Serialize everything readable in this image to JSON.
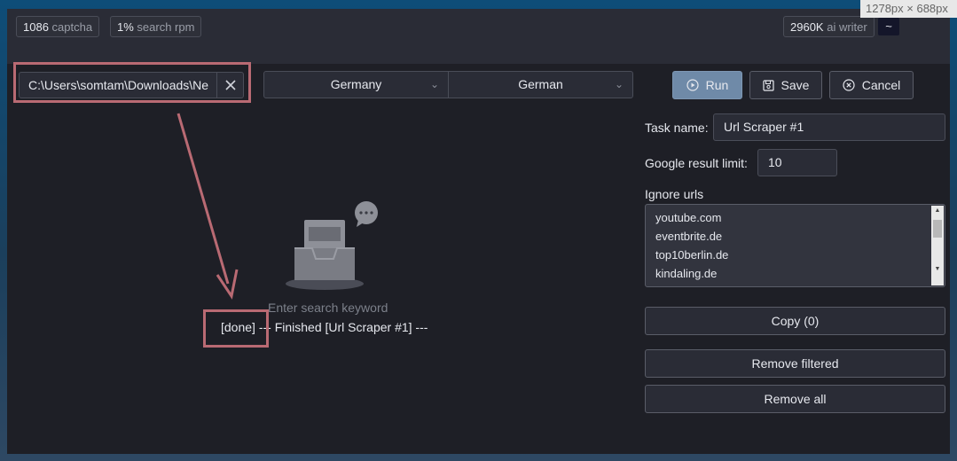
{
  "stats": {
    "captcha": {
      "value": "1086",
      "unit": "captcha"
    },
    "search_rpm": {
      "value": "1%",
      "unit": "search rpm"
    },
    "ai_writer": {
      "value": "2960K",
      "unit": "ai writer"
    },
    "tilde": "~"
  },
  "size_tooltip": "1278px × 688px",
  "file_path": {
    "value": "C:\\Users\\somtam\\Downloads\\Ne"
  },
  "country_select": {
    "selected": "Germany"
  },
  "language_select": {
    "selected": "German"
  },
  "buttons": {
    "run": "Run",
    "save": "Save",
    "cancel": "Cancel"
  },
  "form": {
    "task_name_label": "Task name:",
    "task_name_value": "Url Scraper #1",
    "google_limit_label": "Google result limit:",
    "google_limit_value": "10",
    "ignore_urls_label": "Ignore urls",
    "ignore_urls": [
      "youtube.com",
      "eventbrite.de",
      "top10berlin.de",
      "kindaling.de"
    ]
  },
  "actions": {
    "copy": "Copy (0)",
    "remove_filtered": "Remove filtered",
    "remove_all": "Remove all"
  },
  "empty_state": {
    "placeholder": "Enter search keyword"
  },
  "log": {
    "status": "[done]",
    "message": " --- Finished [Url Scraper #1] ---"
  },
  "colors": {
    "annotation": "#b96a73",
    "run_button": "#6f8aa8",
    "panel": "#1e1f26"
  }
}
